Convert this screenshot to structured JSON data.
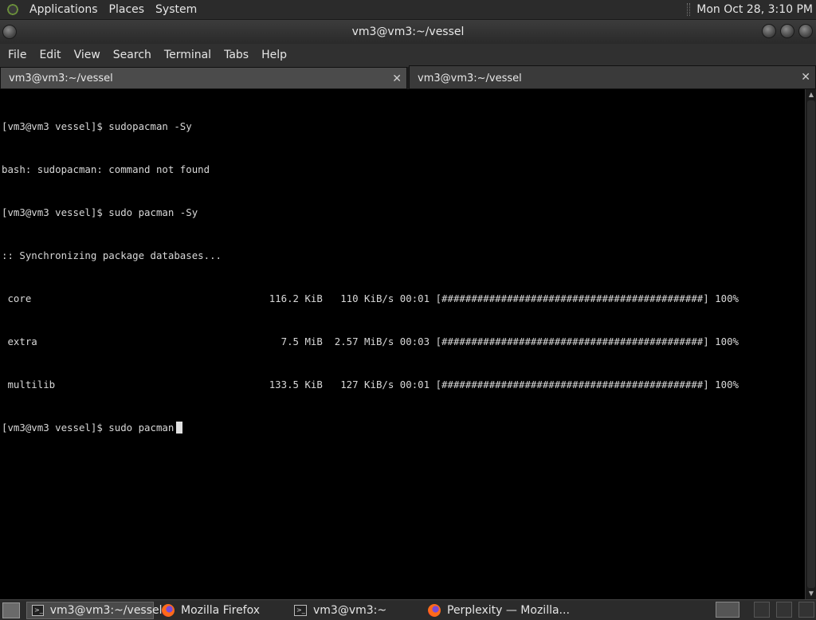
{
  "top_panel": {
    "menus": [
      "Applications",
      "Places",
      "System"
    ],
    "clock": "Mon Oct 28,  3:10 PM"
  },
  "window": {
    "title": "vm3@vm3:~/vessel"
  },
  "menubar": {
    "items": [
      "File",
      "Edit",
      "View",
      "Search",
      "Terminal",
      "Tabs",
      "Help"
    ]
  },
  "tabs": [
    {
      "label": "vm3@vm3:~/vessel",
      "close": "✕"
    },
    {
      "label": "vm3@vm3:~/vessel",
      "close": "✕"
    }
  ],
  "terminal": {
    "lines": [
      "[vm3@vm3 vessel]$ sudopacman -Sy",
      "bash: sudopacman: command not found",
      "[vm3@vm3 vessel]$ sudo pacman -Sy",
      ":: Synchronizing package databases...",
      " core                                        116.2 KiB   110 KiB/s 00:01 [############################################] 100%",
      " extra                                         7.5 MiB  2.57 MiB/s 00:03 [############################################] 100%",
      " multilib                                    133.5 KiB   127 KiB/s 00:01 [############################################] 100%"
    ],
    "prompt": "[vm3@vm3 vessel]$ sudo pacman"
  },
  "taskbar": {
    "tasks": [
      {
        "label": "vm3@vm3:~/vessel",
        "icon": "terminal-icon"
      },
      {
        "label": "Mozilla Firefox",
        "icon": "firefox-icon"
      },
      {
        "label": "vm3@vm3:~",
        "icon": "terminal-icon"
      },
      {
        "label": "Perplexity — Mozilla...",
        "icon": "firefox-icon"
      }
    ]
  }
}
